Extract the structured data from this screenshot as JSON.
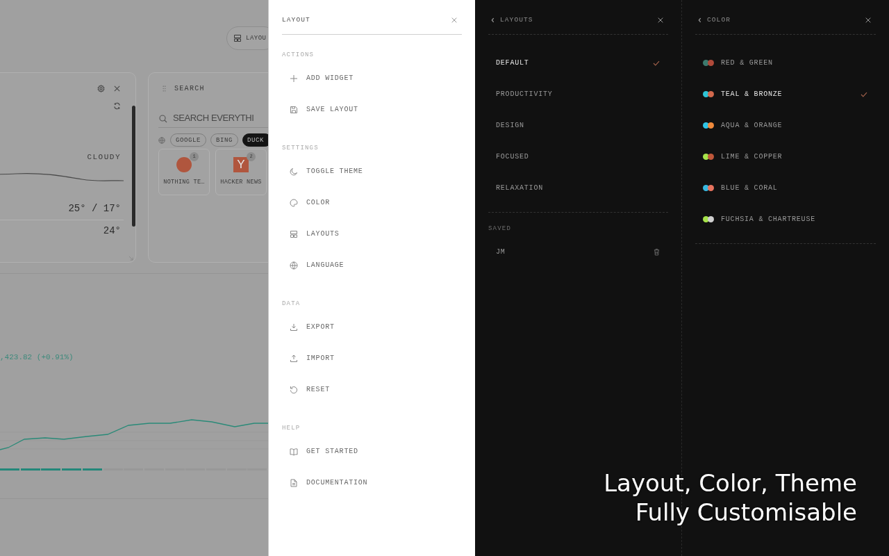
{
  "dashboard": {
    "layout_button": {
      "label": "LAYOU"
    },
    "weather": {
      "condition": "CLOUDY",
      "high_low": "25° / 17°",
      "current": "24°"
    },
    "search": {
      "title": "SEARCH",
      "placeholder": "SEARCH EVERYTHI",
      "engines": [
        {
          "label": "GOOGLE",
          "selected": false
        },
        {
          "label": "BING",
          "selected": false
        },
        {
          "label": "DUCK",
          "selected": true
        }
      ],
      "shortcuts": [
        {
          "kind": "dot",
          "label": "NOTHING TE…",
          "badge": "1"
        },
        {
          "kind": "letter",
          "logo": "Y",
          "label": "HACKER NEWS",
          "badge": "2"
        }
      ]
    },
    "stock": {
      "change": ",423.82 (+0.91%)",
      "level": 0.38
    }
  },
  "layout_menu": {
    "title": "LAYOUT",
    "sections": [
      {
        "label": "ACTIONS",
        "items": [
          "ADD WIDGET",
          "SAVE LAYOUT"
        ]
      },
      {
        "label": "SETTINGS",
        "items": [
          "TOGGLE THEME",
          "COLOR",
          "LAYOUTS",
          "LANGUAGE"
        ]
      },
      {
        "label": "DATA",
        "items": [
          "EXPORT",
          "IMPORT",
          "RESET"
        ]
      },
      {
        "label": "HELP",
        "items": [
          "GET STARTED",
          "DOCUMENTATION"
        ]
      }
    ]
  },
  "layouts_panel": {
    "title": "LAYOUTS",
    "presets": [
      {
        "label": "DEFAULT",
        "selected": true
      },
      {
        "label": "PRODUCTIVITY",
        "selected": false
      },
      {
        "label": "DESIGN",
        "selected": false
      },
      {
        "label": "FOCUSED",
        "selected": false
      },
      {
        "label": "RELAXATION",
        "selected": false
      }
    ],
    "saved_label": "SAVED",
    "saved": [
      "JM"
    ]
  },
  "color_panel": {
    "title": "COLOR",
    "schemes": [
      {
        "label": "RED & GREEN",
        "swatches": [
          {
            "color": "#3c7a6e"
          },
          {
            "color": "#b04a3a"
          }
        ],
        "selected": false
      },
      {
        "label": "TEAL & BRONZE",
        "swatches": [
          {
            "color": "#2ec4d6"
          },
          {
            "color": "#d2694d"
          }
        ],
        "selected": true
      },
      {
        "label": "AQUA & ORANGE",
        "swatches": [
          {
            "color": "#2ec4e6"
          },
          {
            "color": "#f08a3c"
          }
        ],
        "selected": false
      },
      {
        "label": "LIME & COPPER",
        "swatches": [
          {
            "color": "#a6e34a"
          },
          {
            "color": "#c0573a"
          }
        ],
        "selected": false
      },
      {
        "label": "BLUE & CORAL",
        "swatches": [
          {
            "color": "#38b8e0"
          },
          {
            "color": "#e8735e"
          }
        ],
        "selected": false
      },
      {
        "label": "FUCHSIA & CHARTREUSE",
        "swatches": [
          {
            "color": "#a6e34a"
          },
          {
            "color": "#d0d0d0"
          }
        ],
        "selected": false
      }
    ]
  },
  "caption": [
    "Layout, Color, Theme",
    "Fully Customisable"
  ]
}
